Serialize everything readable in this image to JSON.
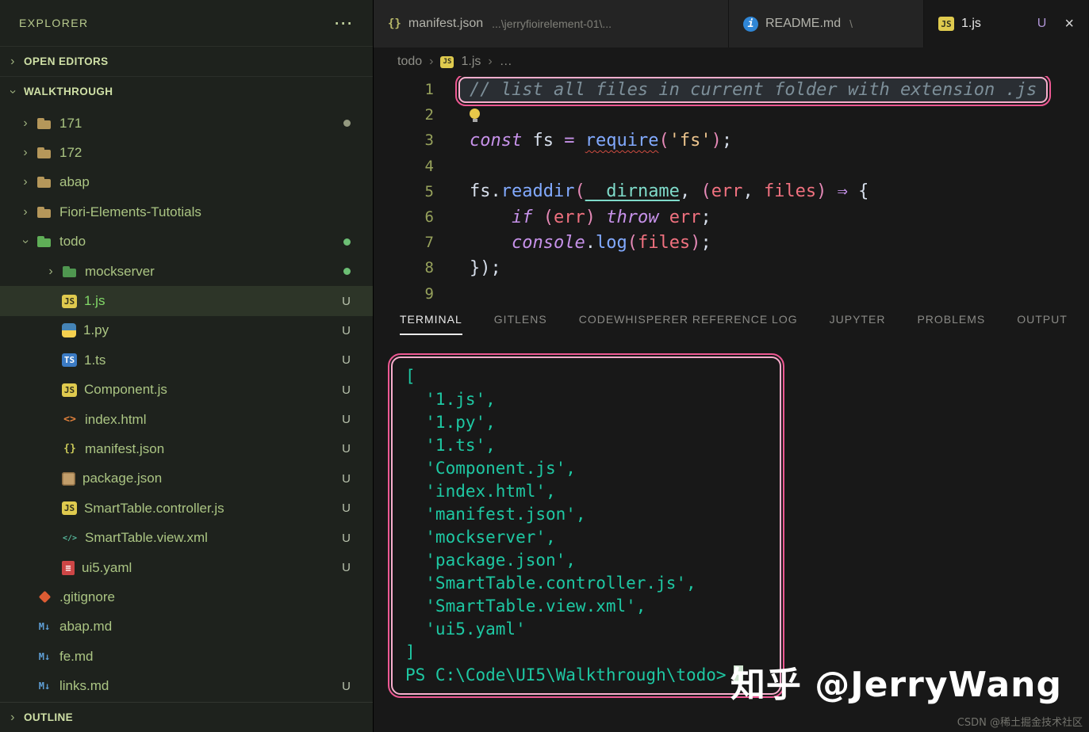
{
  "sidebar": {
    "header": "EXPLORER",
    "menu_icon": "⋯",
    "sections": {
      "open_editors": "OPEN EDITORS",
      "walkthrough": "WALKTHROUGH",
      "outline": "OUTLINE"
    },
    "tree": [
      {
        "label": "171",
        "type": "folder",
        "level": 0,
        "chevron": ">",
        "dot": "gray"
      },
      {
        "label": "172",
        "type": "folder",
        "level": 0,
        "chevron": ">"
      },
      {
        "label": "abap",
        "type": "folder",
        "level": 0,
        "chevron": ">"
      },
      {
        "label": "Fiori-Elements-Tutotials",
        "type": "folder",
        "level": 0,
        "chevron": ">"
      },
      {
        "label": "todo",
        "type": "folder-open",
        "level": 0,
        "chevron": "v",
        "dot": "green"
      },
      {
        "label": "mockserver",
        "type": "folder-sub",
        "level": 1,
        "chevron": ">",
        "dot": "green"
      },
      {
        "label": "1.js",
        "type": "js",
        "level": 1,
        "badge": "U",
        "selected": true
      },
      {
        "label": "1.py",
        "type": "py",
        "level": 1,
        "badge": "U"
      },
      {
        "label": "1.ts",
        "type": "ts",
        "level": 1,
        "badge": "U"
      },
      {
        "label": "Component.js",
        "type": "js",
        "level": 1,
        "badge": "U"
      },
      {
        "label": "index.html",
        "type": "html",
        "level": 1,
        "badge": "U"
      },
      {
        "label": "manifest.json",
        "type": "json",
        "level": 1,
        "badge": "U"
      },
      {
        "label": "package.json",
        "type": "npm",
        "level": 1,
        "badge": "U"
      },
      {
        "label": "SmartTable.controller.js",
        "type": "js",
        "level": 1,
        "badge": "U"
      },
      {
        "label": "SmartTable.view.xml",
        "type": "xml",
        "level": 1,
        "badge": "U"
      },
      {
        "label": "ui5.yaml",
        "type": "yaml",
        "level": 1,
        "badge": "U"
      },
      {
        "label": ".gitignore",
        "type": "git",
        "level": 0
      },
      {
        "label": "abap.md",
        "type": "md",
        "level": 0
      },
      {
        "label": "fe.md",
        "type": "md",
        "level": 0
      },
      {
        "label": "links.md",
        "type": "md",
        "level": 0,
        "badge": "U"
      }
    ]
  },
  "tabs": [
    {
      "title": "manifest.json",
      "detail": "...\\jerryfioirelement-01\\...",
      "icon": "json"
    },
    {
      "title": "README.md",
      "detail": "\\",
      "icon": "info"
    },
    {
      "title": "1.js",
      "icon": "js",
      "badge": "U",
      "close": "×",
      "active": true
    }
  ],
  "breadcrumb": {
    "items": [
      "todo",
      "1.js",
      "…"
    ]
  },
  "editor": {
    "lines": [
      {
        "n": 1,
        "boxed": true,
        "tokens": [
          {
            "t": "// list all files in current folder with extension .js",
            "c": "comment"
          }
        ]
      },
      {
        "n": 2,
        "bulb": true,
        "tokens": []
      },
      {
        "n": 3,
        "tokens": [
          {
            "t": "const",
            "c": "kw"
          },
          {
            "t": " fs ",
            "c": "var"
          },
          {
            "t": "=",
            "c": "op"
          },
          {
            "t": " ",
            "c": "plain"
          },
          {
            "t": "require",
            "c": "fn sq"
          },
          {
            "t": "(",
            "c": "paren"
          },
          {
            "t": "'fs'",
            "c": "str"
          },
          {
            "t": ")",
            "c": "paren"
          },
          {
            "t": ";",
            "c": "plain"
          }
        ]
      },
      {
        "n": 4,
        "tokens": []
      },
      {
        "n": 5,
        "tokens": [
          {
            "t": "fs",
            "c": "var"
          },
          {
            "t": ".",
            "c": "plain"
          },
          {
            "t": "readdir",
            "c": "fn"
          },
          {
            "t": "(",
            "c": "paren"
          },
          {
            "t": "__dirname",
            "c": "builtin"
          },
          {
            "t": ", ",
            "c": "plain"
          },
          {
            "t": "(",
            "c": "paren"
          },
          {
            "t": "err",
            "c": "param"
          },
          {
            "t": ", ",
            "c": "plain"
          },
          {
            "t": "files",
            "c": "param"
          },
          {
            "t": ")",
            "c": "paren"
          },
          {
            "t": " ",
            "c": "plain"
          },
          {
            "t": "⇒",
            "c": "op"
          },
          {
            "t": " {",
            "c": "plain"
          }
        ]
      },
      {
        "n": 6,
        "tokens": [
          {
            "t": "    ",
            "c": "plain"
          },
          {
            "t": "if",
            "c": "kw"
          },
          {
            "t": " ",
            "c": "plain"
          },
          {
            "t": "(",
            "c": "paren"
          },
          {
            "t": "err",
            "c": "param"
          },
          {
            "t": ")",
            "c": "paren"
          },
          {
            "t": " ",
            "c": "plain"
          },
          {
            "t": "throw",
            "c": "kw"
          },
          {
            "t": " ",
            "c": "plain"
          },
          {
            "t": "err",
            "c": "param"
          },
          {
            "t": ";",
            "c": "plain"
          }
        ]
      },
      {
        "n": 7,
        "tokens": [
          {
            "t": "    ",
            "c": "plain"
          },
          {
            "t": "console",
            "c": "kw"
          },
          {
            "t": ".",
            "c": "plain"
          },
          {
            "t": "log",
            "c": "fn"
          },
          {
            "t": "(",
            "c": "paren"
          },
          {
            "t": "files",
            "c": "param"
          },
          {
            "t": ")",
            "c": "paren"
          },
          {
            "t": ";",
            "c": "plain"
          }
        ]
      },
      {
        "n": 8,
        "tokens": [
          {
            "t": "});",
            "c": "plain"
          }
        ]
      },
      {
        "n": 9,
        "tokens": []
      }
    ]
  },
  "panel": {
    "tabs": [
      "TERMINAL",
      "GITLENS",
      "CODEWHISPERER REFERENCE LOG",
      "JUPYTER",
      "PROBLEMS",
      "OUTPUT"
    ],
    "active_tab": "TERMINAL"
  },
  "terminal": {
    "output": [
      "[",
      "  '1.js',",
      "  '1.py',",
      "  '1.ts',",
      "  'Component.js',",
      "  'index.html',",
      "  'manifest.json',",
      "  'mockserver',",
      "  'package.json',",
      "  'SmartTable.controller.js',",
      "  'SmartTable.view.xml',",
      "  'ui5.yaml'",
      "]"
    ],
    "prompt": "PS C:\\Code\\UI5\\Walkthrough\\todo>"
  },
  "watermarks": {
    "large": "知乎 @JerryWang",
    "small": "CSDN @稀土掘金技术社区"
  },
  "colors": {
    "annotation_pink": "#ee5893",
    "terminal_green": "#1ec8a3",
    "modified_green": "#6cbf74"
  }
}
